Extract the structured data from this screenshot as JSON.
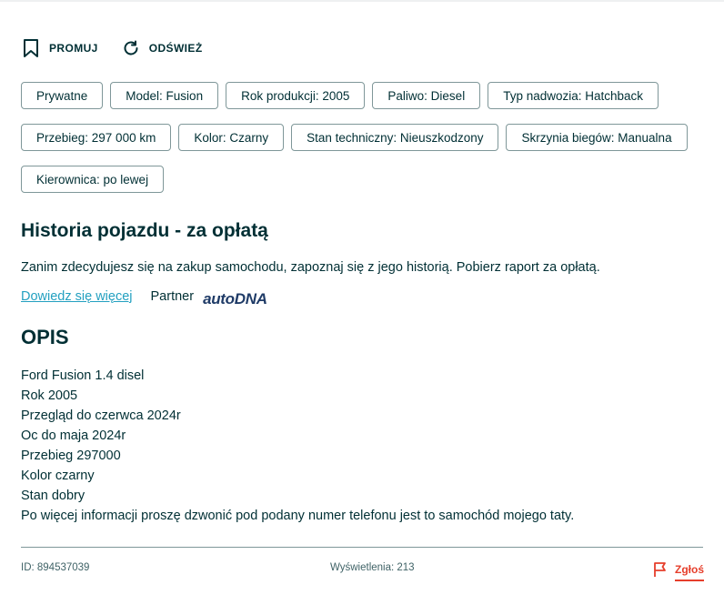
{
  "actions": {
    "promote_label": "PROMUJ",
    "refresh_label": "ODŚWIEŻ"
  },
  "tags": [
    "Prywatne",
    "Model: Fusion",
    "Rok produkcji: 2005",
    "Paliwo: Diesel",
    "Typ nadwozia: Hatchback",
    "Przebieg: 297 000 km",
    "Kolor: Czarny",
    "Stan techniczny: Nieuszkodzony",
    "Skrzynia biegów: Manualna",
    "Kierownica: po lewej"
  ],
  "history": {
    "title": "Historia pojazdu - za opłatą",
    "text": "Zanim zdecydujesz się na zakup samochodu, zapoznaj się z jego historią. Pobierz raport za opłatą.",
    "learn_more": "Dowiedz się więcej",
    "partner_label": "Partner",
    "partner_logo": "autoDNA"
  },
  "description": {
    "title": "OPIS",
    "lines": [
      "Ford Fusion 1.4 disel",
      "Rok 2005",
      "Przegląd do czerwca 2024r",
      "Oc do maja 2024r",
      "Przebieg 297000",
      "Kolor czarny",
      "Stan dobry",
      "Po więcej informacji proszę dzwonić pod podany numer telefonu jest to samochód mojego taty."
    ]
  },
  "footer": {
    "id_text": "ID: 894537039",
    "views_text": "Wyświetlenia: 213",
    "report_label": "Zgłoś"
  },
  "colors": {
    "text": "#002f34",
    "border": "#7f9799",
    "link": "#23a0c0",
    "report": "#e63e2b",
    "logo": "#1f3b67"
  }
}
